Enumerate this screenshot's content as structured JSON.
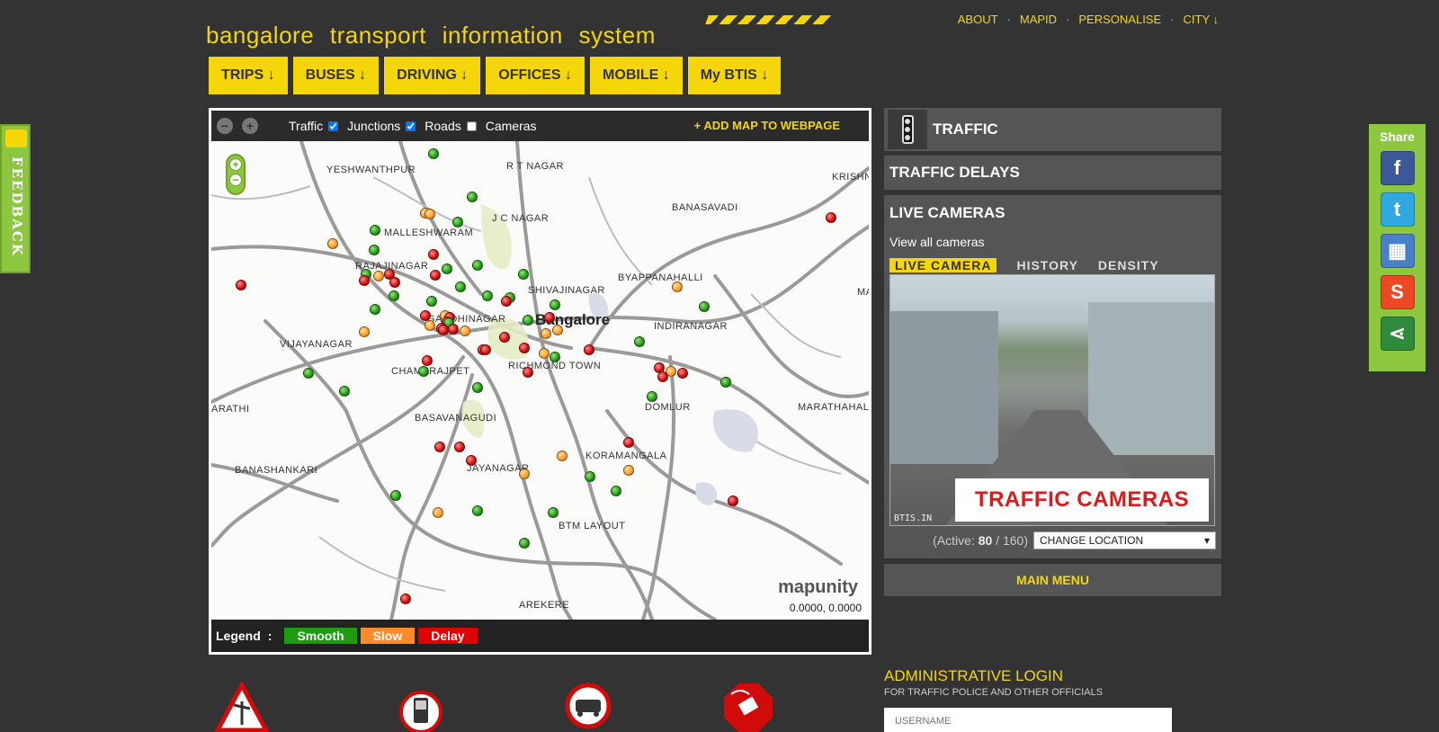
{
  "header": {
    "logo_text": "bangalore transport information system",
    "top_links": [
      "ABOUT",
      "MAPID",
      "PERSONALISE",
      "CITY ↓"
    ],
    "link_separator": "·"
  },
  "nav": [
    "TRIPS ↓",
    "BUSES ↓",
    "DRIVING ↓",
    "OFFICES ↓",
    "MOBILE ↓",
    "My BTIS ↓"
  ],
  "feedback": {
    "label": "FEEDBACK"
  },
  "share": {
    "title": "Share",
    "buttons": [
      "facebook",
      "twitter",
      "delicious",
      "stumbleupon",
      "share"
    ]
  },
  "map": {
    "zoom_out": "−",
    "zoom_in": "+",
    "layers": [
      {
        "label": "Traffic",
        "checked": true
      },
      {
        "label": "Junctions",
        "checked": true
      },
      {
        "label": "Roads",
        "checked": false
      },
      {
        "label": "Cameras",
        "checked": false
      }
    ],
    "add_map": "+ ADD MAP TO WEBPAGE",
    "city": "Bangalore",
    "places": [
      "YESHWANTHPUR",
      "R T NAGAR",
      "KRISHNA",
      "BANASAVADI",
      "J C NAGAR",
      "MALLESHWARAM",
      "RAJAJINAGAR",
      "BYAPPANAHALLI",
      "SHIVAJINAGAR",
      "GANDHINAGAR",
      "INDIRANAGAR",
      "MA",
      "VIJAYANAGAR",
      "CHAMARAJPET",
      "RICHMOND TOWN",
      "DOMLUR",
      "MARATHAHALLI",
      "ARATHI",
      "BASAVANAGUDI",
      "KORAMANGALA",
      "BANASHANKARI",
      "JAYANAGAR",
      "BTM LAYOUT",
      "AREKERE"
    ],
    "brand": "mapunity",
    "coords": "0.0000, 0.0000",
    "legend_label": "Legend",
    "legend_sep": ":",
    "legend": [
      {
        "label": "Smooth",
        "color": "#1e9a13"
      },
      {
        "label": "Slow",
        "color": "#ff8a2a"
      },
      {
        "label": "Delay",
        "color": "#e00000"
      }
    ]
  },
  "traffic": {
    "title": "TRAFFIC",
    "delays": "TRAFFIC DELAYS",
    "cams_title": "LIVE CAMERAS",
    "view_all": "View all cameras",
    "tabs": [
      "LIVE CAMERA",
      "HISTORY",
      "DENSITY"
    ],
    "caption": "TRAFFIC CAMERAS",
    "stamp": "BTIS.IN",
    "active_prefix": "(Active: ",
    "active_count": "80",
    "active_total": " / 160)",
    "change_location": "CHANGE LOCATION",
    "main_menu": "MAIN MENU"
  },
  "admin": {
    "title": "ADMINISTRATIVE LOGIN",
    "subtitle": "FOR TRAFFIC POLICE AND OTHER OFFICIALS",
    "username_placeholder": "USERNAME"
  },
  "colors": {
    "accent": "#f5d60a",
    "background": "#333333",
    "panel": "#555555",
    "green": "#8dc63f"
  }
}
